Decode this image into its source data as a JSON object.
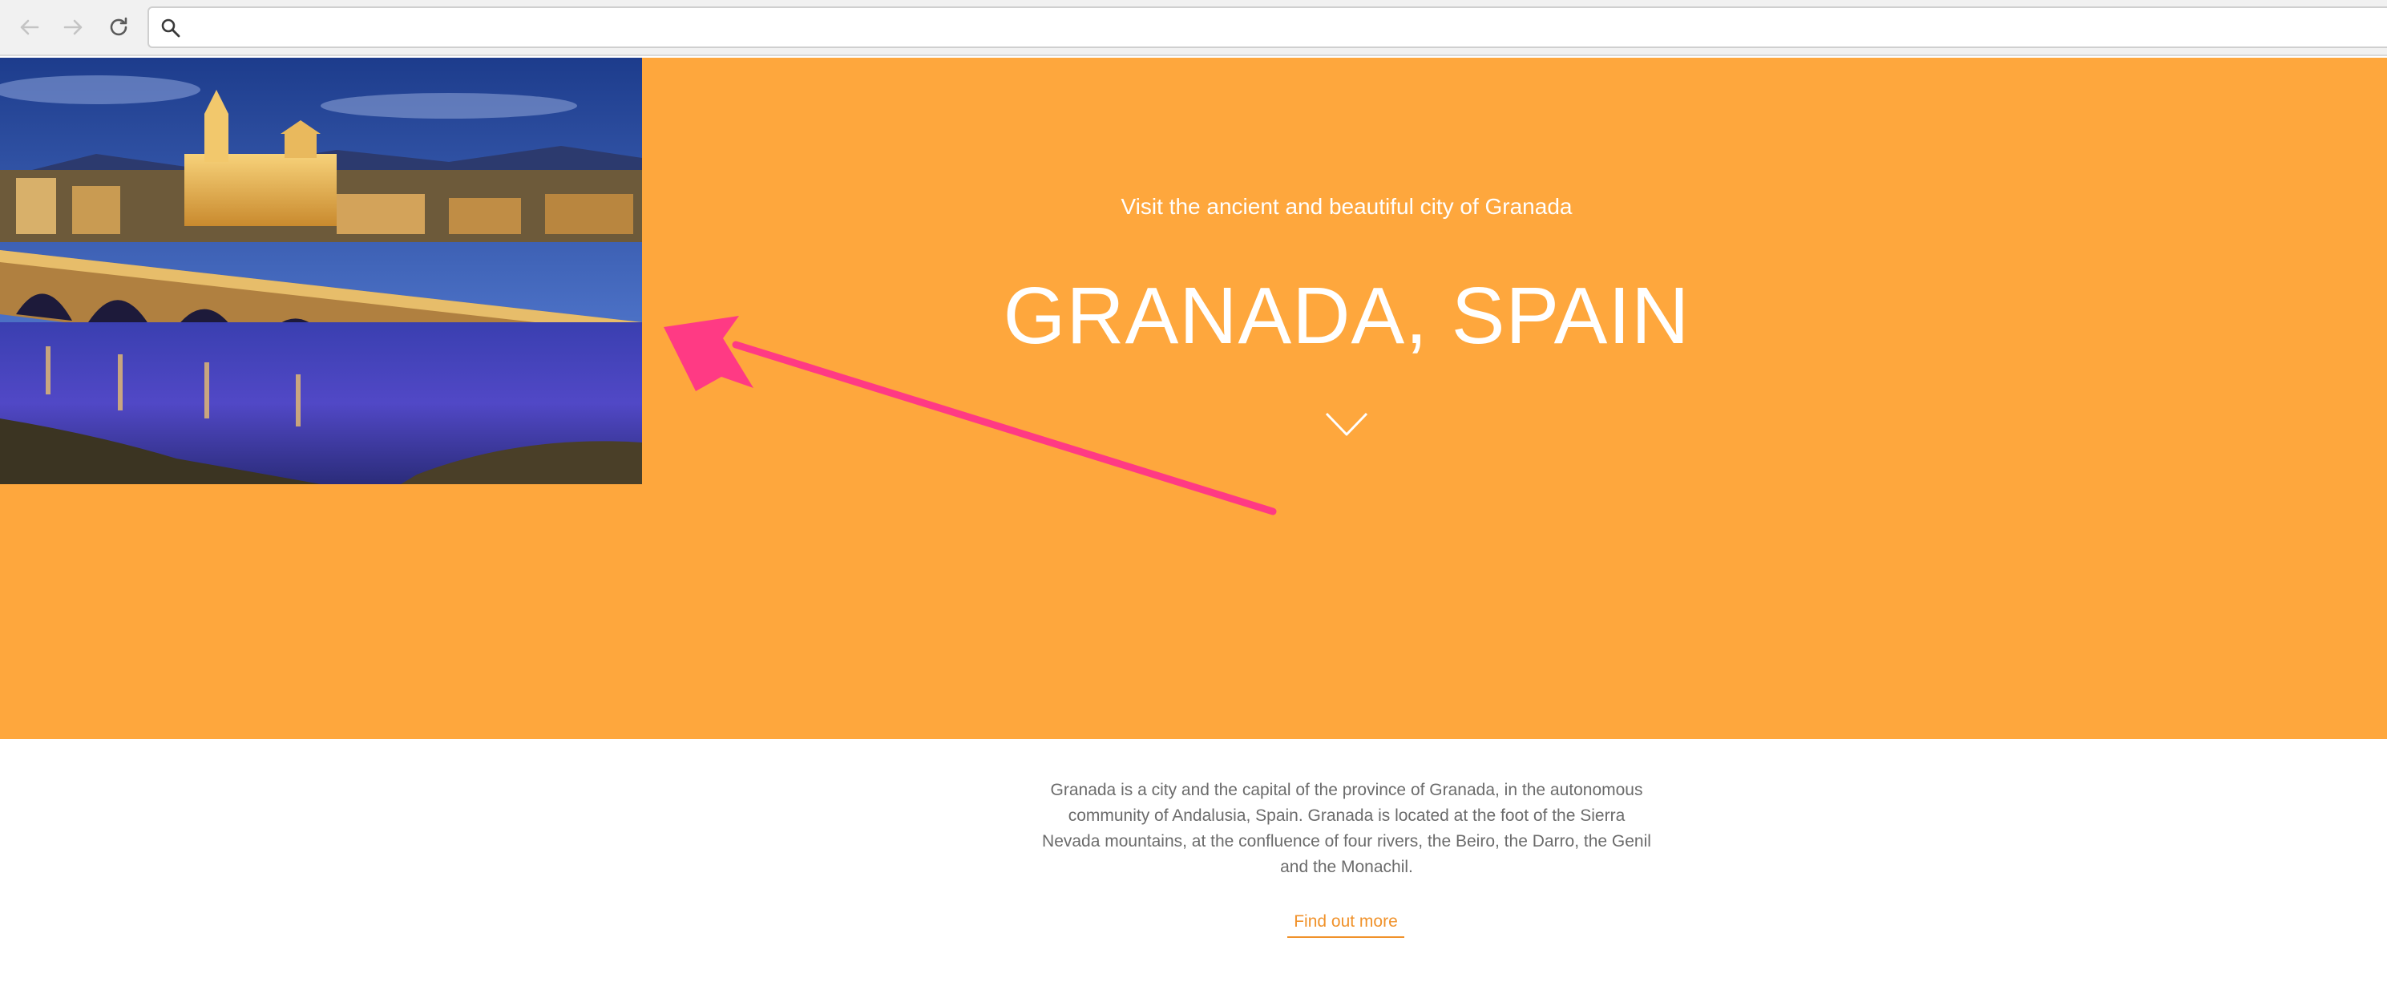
{
  "browser": {
    "address_value": "",
    "address_placeholder": "",
    "icons": [
      "back-arrow-icon",
      "forward-arrow-icon",
      "reload-icon",
      "search-icon"
    ]
  },
  "hero": {
    "background_color": "#fea73d",
    "photo": "night view of illuminated bridge, river and cathedral",
    "subtitle": "Visit the ancient and beautiful city of Granada",
    "title": "GRANADA, SPAIN",
    "scroll_icon": "chevron-down-icon"
  },
  "annotation": {
    "color": "#ff3a84",
    "icon": "annotation-arrow"
  },
  "content": {
    "intro_text": "Granada is a city and the capital of the province of Granada, in the autonomous community of Andalusia, Spain. Granada is located at the foot of the Sierra Nevada mountains, at the confluence of four rivers, the Beiro, the Darro, the Genil and the Monachil.",
    "link_label": "Find out more",
    "text_color": "#6b6b6b",
    "link_color": "#f0922b"
  }
}
